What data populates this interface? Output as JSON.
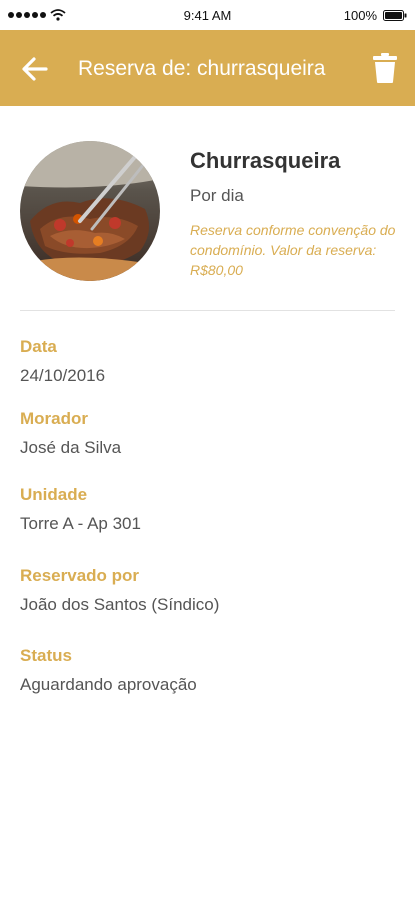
{
  "status_bar": {
    "time": "9:41 AM",
    "battery": "100%"
  },
  "header": {
    "title": "Reserva de: churrasqueira",
    "back_icon": "arrow-left-icon",
    "delete_icon": "trash-icon",
    "color": "#d9ad52"
  },
  "facility": {
    "name": "Churrasqueira",
    "period": "Por dia",
    "note": "Reserva conforme convenção do condomínio. Valor da reserva: R$80,00"
  },
  "fields": [
    {
      "label": "Data",
      "value": "24/10/2016"
    },
    {
      "label": "Morador",
      "value": "José da Silva"
    },
    {
      "label": "Unidade",
      "value": "Torre A - Ap 301"
    },
    {
      "label": "Reservado por",
      "value": "João dos Santos (Síndico)"
    },
    {
      "label": "Status",
      "value": "Aguardando aprovação"
    }
  ]
}
